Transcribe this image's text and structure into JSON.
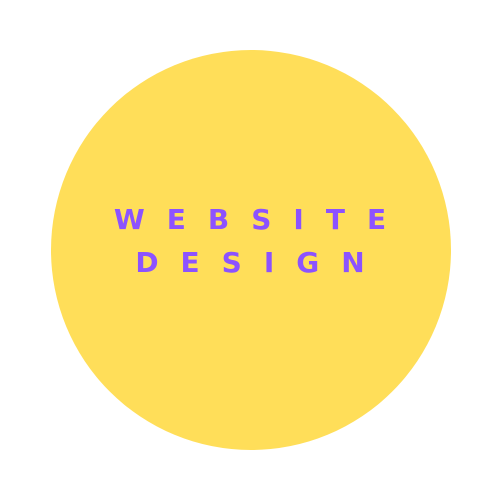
{
  "graphic": {
    "circle_color": "#FFDE59",
    "text_color": "#8C52FF",
    "background_color": "#FFFFFF",
    "line1": "WEBSITE",
    "line2": "DESIGN"
  }
}
